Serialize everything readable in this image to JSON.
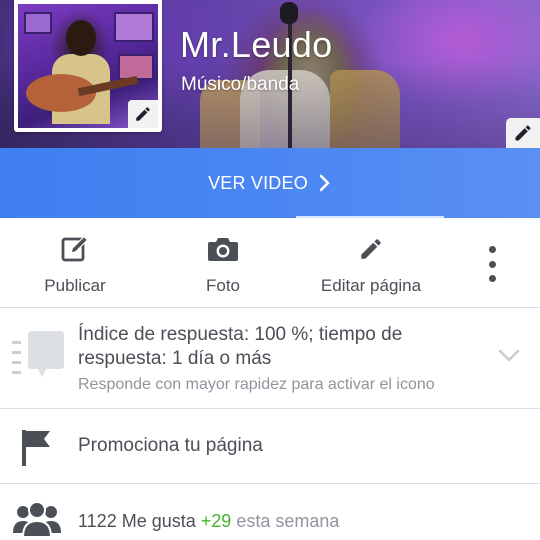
{
  "page": {
    "name": "Mr.Leudo",
    "category": "Músico/banda"
  },
  "cta": {
    "label": "VER VIDEO"
  },
  "actions": {
    "publish": "Publicar",
    "photo": "Foto",
    "edit_page": "Editar página"
  },
  "response": {
    "title": "Índice de respuesta: 100 %; tiempo de respuesta: 1 día o más",
    "subtitle": "Responde con mayor rapidez para activar el icono"
  },
  "promote": {
    "label": "Promociona tu página"
  },
  "likes": {
    "count_text": "1122 Me gusta",
    "gain_text": "+29",
    "period_text": "esta semana"
  },
  "icons": {
    "profile_edit": "pencil-icon",
    "cover_edit": "pencil-icon",
    "cta_chevron": "chevron-right-icon",
    "publish": "compose-icon",
    "photo": "camera-icon",
    "edit_page": "pencil-icon",
    "more": "more-vertical-icon",
    "response": "chat-bubbles-icon",
    "response_expand": "chevron-down-icon",
    "promote": "flag-icon",
    "likes": "people-icon"
  },
  "colors": {
    "cta_bar": "#4a86f2",
    "text_primary": "#4b4f56",
    "text_secondary": "#90949c",
    "gain": "#42b72a",
    "icon_dark": "#4b4f56",
    "icon_light": "#c9cdd4"
  }
}
